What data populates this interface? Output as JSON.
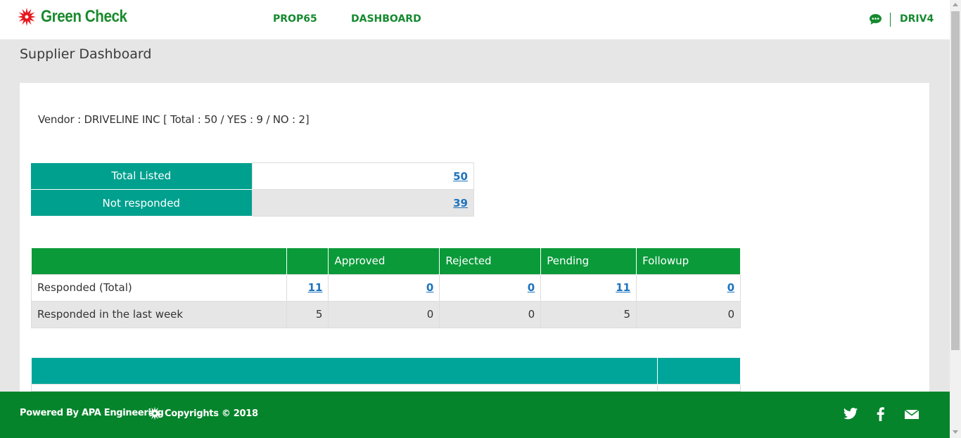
{
  "header": {
    "logo_text": "Green Check",
    "nav": [
      {
        "label": "PROP65"
      },
      {
        "label": "DASHBOARD"
      }
    ],
    "user_name": "DRIV4",
    "brand_color": "#1b8a2f"
  },
  "page": {
    "title": "Supplier Dashboard"
  },
  "vendor": {
    "text": "Vendor : DRIVELINE INC [ Total : 50 / YES : 9 / NO : 2]"
  },
  "summary": [
    {
      "label": "Total Listed",
      "value": "50"
    },
    {
      "label": "Not responded",
      "value": "39"
    }
  ],
  "responses": {
    "headers": [
      "",
      "",
      "Approved",
      "Rejected",
      "Pending",
      "Followup"
    ],
    "rows": [
      {
        "label": "Responded (Total)",
        "values": [
          "11",
          "0",
          "0",
          "11",
          "0"
        ],
        "linked": true
      },
      {
        "label": "Responded in the last week",
        "values": [
          "5",
          "0",
          "0",
          "5",
          "0"
        ],
        "linked": false
      }
    ],
    "header_color": "#0b9a3a"
  },
  "footer": {
    "powered": "Powered By APA Engineering",
    "copyright": "Copyrights © 2018",
    "social": [
      "twitter-icon",
      "facebook-icon",
      "mail-icon"
    ],
    "bg_color": "#05842c"
  }
}
